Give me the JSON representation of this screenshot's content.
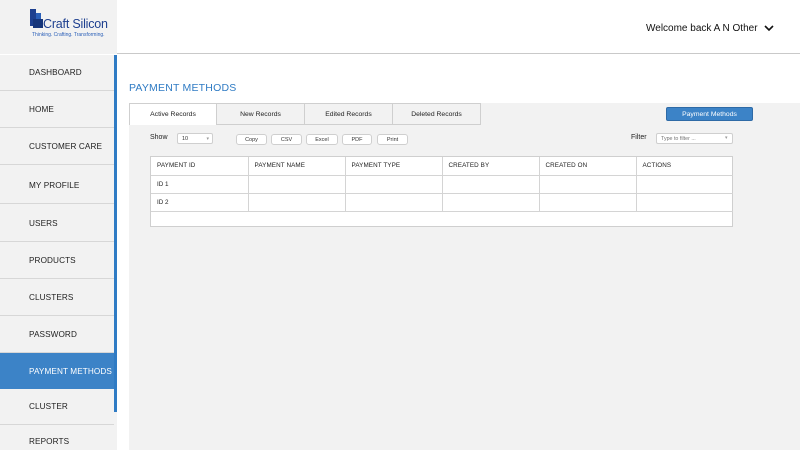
{
  "header": {
    "logo_name": "Craft Silicon",
    "logo_tagline": "Thinking. Crafting. Transforming.",
    "welcome_text": "Welcome back A N Other"
  },
  "sidebar": {
    "items": [
      {
        "label": "DASHBOARD",
        "active": false
      },
      {
        "label": "HOME",
        "active": false
      },
      {
        "label": "CUSTOMER CARE",
        "active": false
      },
      {
        "label": "MY PROFILE",
        "active": false
      },
      {
        "label": "USERS",
        "active": false
      },
      {
        "label": "PRODUCTS",
        "active": false
      },
      {
        "label": "CLUSTERS",
        "active": false
      },
      {
        "label": "PASSWORD",
        "active": false
      },
      {
        "label": "PAYMENT METHODS",
        "active": true
      },
      {
        "label": "CLUSTER",
        "active": false
      },
      {
        "label": "REPORTS",
        "active": false
      }
    ]
  },
  "main": {
    "title": "PAYMENT METHODS",
    "tabs": [
      "Active Records",
      "New Records",
      "Edited Records",
      "Deleted Records"
    ],
    "primary_button": "Payment Methods",
    "show_label": "Show",
    "show_value": "10",
    "export_buttons": [
      "Copy",
      "CSV",
      "Excel",
      "PDF",
      "Print"
    ],
    "filter_label": "Filter",
    "filter_placeholder": "Type to filter ..."
  },
  "table": {
    "columns": [
      "PAYMENT ID",
      "PAYMENT NAME",
      "PAYMENT TYPE",
      "CREATED BY",
      "CREATED ON",
      "ACTIONS"
    ],
    "rows": [
      [
        "ID 1",
        "",
        "",
        "",
        "",
        ""
      ],
      [
        "ID 2",
        "",
        "",
        "",
        "",
        ""
      ]
    ]
  },
  "colors": {
    "accent": "#3c83c7",
    "title": "#2f7bc4",
    "sidebar_bg": "#f2f2f2"
  }
}
